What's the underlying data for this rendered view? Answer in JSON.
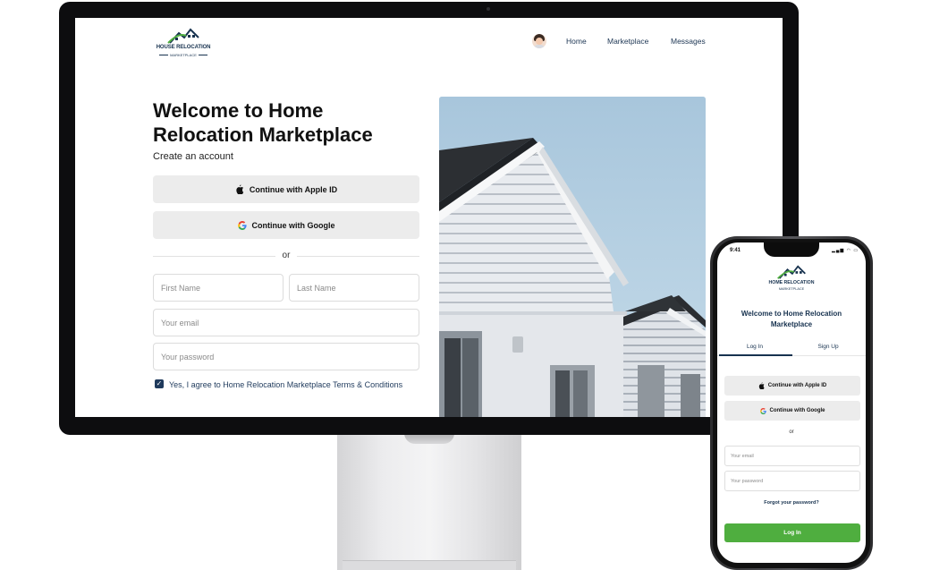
{
  "desktop": {
    "logo": {
      "title": "HOUSE RELOCATION",
      "subtitle": "MARKETPLACE"
    },
    "nav": {
      "home": "Home",
      "marketplace": "Marketplace",
      "messages": "Messages"
    },
    "heading": "Welcome to Home Relocation Marketplace",
    "subheading": "Create an account",
    "apple_button": "Continue with Apple ID",
    "google_button": "Continue with Google",
    "divider": "or",
    "first_name_placeholder": "First Name",
    "last_name_placeholder": "Last Name",
    "email_placeholder": "Your email",
    "password_placeholder": "Your password",
    "terms_label": "Yes, I agree to Home Relocation Marketplace Terms & Conditions",
    "terms_checked": true
  },
  "mobile": {
    "status_time": "9:41",
    "logo": {
      "title": "HOME RELOCATION",
      "subtitle": "MARKETPLACE"
    },
    "heading": "Welcome to Home Relocation Marketplace",
    "tabs": [
      "Log In",
      "Sign Up"
    ],
    "active_tab": "Log In",
    "apple_button": "Continue with Apple ID",
    "google_button": "Continue with Google",
    "divider": "or",
    "email_placeholder": "Your email",
    "password_placeholder": "Your password",
    "forgot_password": "Forgot your password?",
    "login_button": "Log In"
  },
  "colors": {
    "brand_navy": "#17324f",
    "brand_green": "#4fae3f",
    "button_gray": "#ececec"
  },
  "icons": [
    "apple-icon",
    "google-icon",
    "check-icon",
    "house-logo-icon"
  ]
}
